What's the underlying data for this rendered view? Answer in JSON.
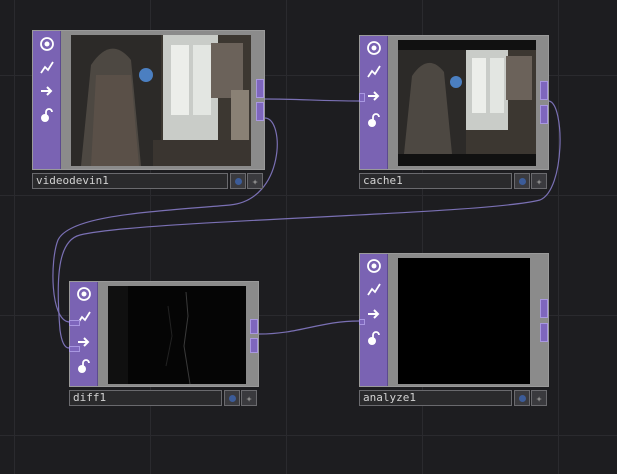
{
  "network": {
    "nodes": [
      {
        "id": "videodevin1",
        "label": "videodevin1",
        "view": "camera"
      },
      {
        "id": "cache1",
        "label": "cache1",
        "view": "camera"
      },
      {
        "id": "diff1",
        "label": "diff1",
        "view": "difference"
      },
      {
        "id": "analyze1",
        "label": "analyze1",
        "view": "black"
      }
    ],
    "connections": [
      {
        "from": "videodevin1",
        "to": "cache1"
      },
      {
        "from": "videodevin1",
        "to": "diff1"
      },
      {
        "from": "cache1",
        "to": "diff1"
      },
      {
        "from": "diff1",
        "to": "analyze1"
      }
    ],
    "strip_icons": [
      "viewer-icon",
      "bypass-icon",
      "display-icon",
      "lock-icon"
    ],
    "colors": {
      "operator_strip": "#7a63b3",
      "wire": "#7a70b4",
      "background": "#1d1d20",
      "flag_dot": "#3c5c99"
    }
  }
}
